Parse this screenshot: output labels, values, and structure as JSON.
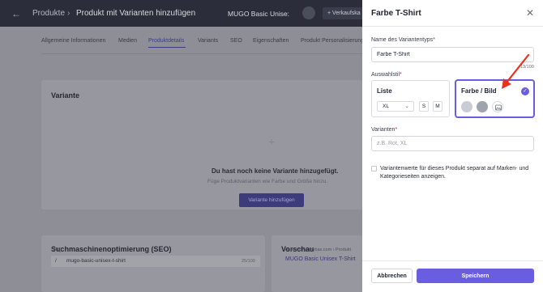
{
  "header": {
    "breadcrumb_root": "Produkte",
    "breadcrumb_separator": "›",
    "breadcrumb_current": "Produkt mit Varianten hinzufügen",
    "product_name": "MUGO Basic Unise:",
    "action_button": "+ Verkaufska"
  },
  "tabs": [
    "Allgemeine Informationen",
    "Medien",
    "Produktdetails",
    "Variants",
    "SEO",
    "Eigenschaften",
    "Produkt Personalisierung"
  ],
  "active_tab": "Produktdetails",
  "variant_section": {
    "title": "Variante",
    "empty_title": "Du hast noch keine Variante hinzugefügt.",
    "empty_hint": "Füge Produktvarianten wie Farbe und Größe hinzu.",
    "add_button": "Variante hinzufügen"
  },
  "seo_section": {
    "title": "Suchmaschinenoptimierung (SEO)",
    "slug_label": "Slug",
    "slug_prefix": "/",
    "slug_value": "mugo-basic-unisex-t-shirt",
    "slug_count": "25/100"
  },
  "preview_section": {
    "title": "Vorschau",
    "url": "onboarding.mybas.com › Produkt",
    "link": "MUGO Basic Unisex T-Shirt"
  },
  "panel": {
    "title": "Farbe T-Shirt",
    "variant_type_label": "Name des Variantentyps",
    "variant_type_value": "Farbe T-Shirt",
    "char_count": "13/100",
    "display_style_label": "Auswahlstil",
    "options": {
      "list": {
        "title": "Liste",
        "select_value": "XL",
        "chips": [
          "S",
          "M"
        ]
      },
      "color_image": {
        "title": "Farbe / Bild",
        "selected": true
      }
    },
    "variants_label": "Varianten",
    "variants_placeholder": "z.B. Rot, XL",
    "checkbox_label": "Variantenwerte für dieses Produkt separat auf Marken- und Kategorieseiten anzeigen.",
    "required_marker": "*",
    "cancel_button": "Abbrechen",
    "save_button": "Speichern"
  },
  "colors": {
    "accent": "#6b5de0",
    "annotation_arrow": "#e8321f",
    "swatch_light": "#c9ccd4",
    "swatch_dark": "#9fa3ad"
  }
}
